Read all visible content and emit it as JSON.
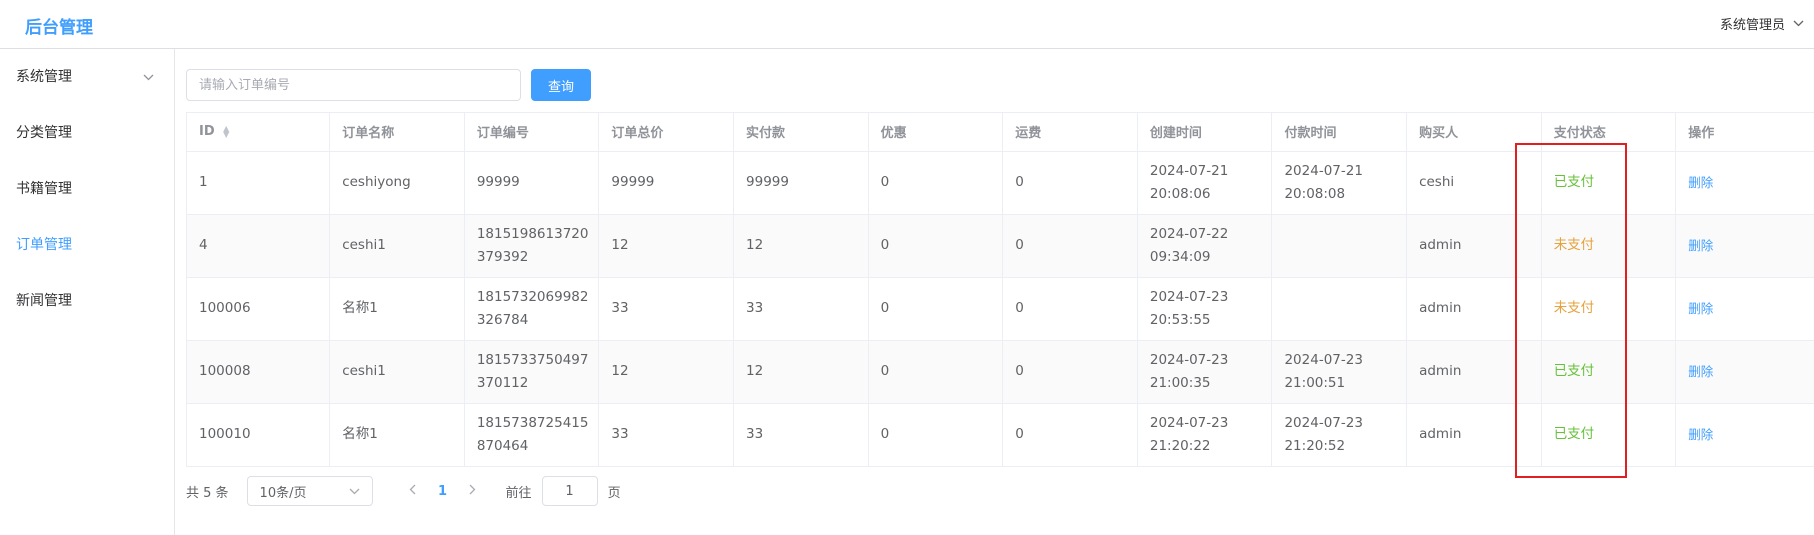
{
  "header": {
    "brand": "后台管理",
    "user": "系统管理员"
  },
  "sidebar": {
    "items": [
      {
        "label": "系统管理",
        "expandable": true,
        "active": false
      },
      {
        "label": "分类管理",
        "expandable": false,
        "active": false
      },
      {
        "label": "书籍管理",
        "expandable": false,
        "active": false
      },
      {
        "label": "订单管理",
        "expandable": false,
        "active": true
      },
      {
        "label": "新闻管理",
        "expandable": false,
        "active": false
      }
    ]
  },
  "search": {
    "placeholder": "请输入订单编号",
    "value": "",
    "button": "查询"
  },
  "table": {
    "columns": [
      "ID",
      "订单名称",
      "订单编号",
      "订单总价",
      "实付款",
      "优惠",
      "运费",
      "创建时间",
      "付款时间",
      "购买人",
      "支付状态",
      "操作"
    ],
    "rows": [
      {
        "id": "1",
        "name": "ceshiyong",
        "order_no_1": "99999",
        "order_no_2": "",
        "total": "99999",
        "paid_amount": "99999",
        "discount": "0",
        "shipping": "0",
        "created_date": "2024-07-21",
        "created_time": "20:08:06",
        "paid_date": "2024-07-21",
        "paid_time": "20:08:08",
        "buyer": "ceshi",
        "status": "已支付",
        "action": "删除"
      },
      {
        "id": "4",
        "name": "ceshi1",
        "order_no_1": "1815198613720",
        "order_no_2": "379392",
        "total": "12",
        "paid_amount": "12",
        "discount": "0",
        "shipping": "0",
        "created_date": "2024-07-22",
        "created_time": "09:34:09",
        "paid_date": "",
        "paid_time": "",
        "buyer": "admin",
        "status": "未支付",
        "action": "删除"
      },
      {
        "id": "100006",
        "name": "名称1",
        "order_no_1": "1815732069982",
        "order_no_2": "326784",
        "total": "33",
        "paid_amount": "33",
        "discount": "0",
        "shipping": "0",
        "created_date": "2024-07-23",
        "created_time": "20:53:55",
        "paid_date": "",
        "paid_time": "",
        "buyer": "admin",
        "status": "未支付",
        "action": "删除"
      },
      {
        "id": "100008",
        "name": "ceshi1",
        "order_no_1": "1815733750497",
        "order_no_2": "370112",
        "total": "12",
        "paid_amount": "12",
        "discount": "0",
        "shipping": "0",
        "created_date": "2024-07-23",
        "created_time": "21:00:35",
        "paid_date": "2024-07-23",
        "paid_time": "21:00:51",
        "buyer": "admin",
        "status": "已支付",
        "action": "删除"
      },
      {
        "id": "100010",
        "name": "名称1",
        "order_no_1": "1815738725415",
        "order_no_2": "870464",
        "total": "33",
        "paid_amount": "33",
        "discount": "0",
        "shipping": "0",
        "created_date": "2024-07-23",
        "created_time": "21:20:22",
        "paid_date": "2024-07-23",
        "paid_time": "21:20:52",
        "buyer": "admin",
        "status": "已支付",
        "action": "删除"
      }
    ]
  },
  "pagination": {
    "total": "共 5 条",
    "page_size": "10条/页",
    "current_page": "1",
    "goto_prefix": "前往",
    "goto_value": "1",
    "goto_suffix": "页"
  },
  "colors": {
    "accent": "#409eff",
    "paid": "#67c23a",
    "unpaid": "#e6a23c",
    "highlight_box": "#e02020"
  }
}
